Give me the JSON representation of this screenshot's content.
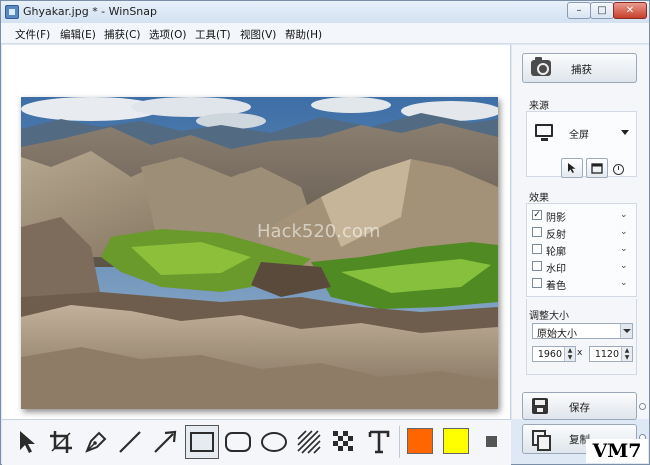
{
  "window": {
    "title": "Ghyakar.jpg * - WinSnap",
    "minimize_label": "–",
    "maximize_label": "□",
    "close_label": "✕"
  },
  "menu": {
    "items": [
      {
        "label": "文件(F)"
      },
      {
        "label": "编辑(E)"
      },
      {
        "label": "捕获(C)"
      },
      {
        "label": "选项(O)"
      },
      {
        "label": "工具(T)"
      },
      {
        "label": "视图(V)"
      },
      {
        "label": "帮助(H)"
      }
    ]
  },
  "canvas": {
    "watermark": "Hack520.com"
  },
  "panel": {
    "capture_label": "捕获",
    "source": {
      "title": "来源",
      "mode": "全屏"
    },
    "effects": {
      "title": "效果",
      "items": [
        {
          "label": "阴影",
          "checked": "✓"
        },
        {
          "label": "反射",
          "checked": ""
        },
        {
          "label": "轮廓",
          "checked": ""
        },
        {
          "label": "水印",
          "checked": ""
        },
        {
          "label": "着色",
          "checked": ""
        }
      ]
    },
    "resize": {
      "title": "调整大小",
      "mode": "原始大小",
      "width": "1960",
      "height": "1120",
      "separator": "x"
    },
    "save_label": "保存",
    "copy_label": "复制"
  },
  "toolbar": {
    "colors": {
      "primary": "#ff6600",
      "secondary": "#ffff00"
    }
  },
  "badge": {
    "text": "VM7"
  }
}
